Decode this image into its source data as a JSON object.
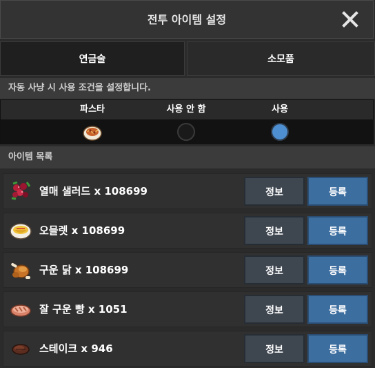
{
  "header": {
    "title": "전투 아이템 설정",
    "close_icon": "close-icon"
  },
  "tabs": [
    {
      "label": "연금술",
      "active": true
    },
    {
      "label": "소모품",
      "active": false
    }
  ],
  "auto_hunt": {
    "description": "자동 사냥 시 사용 조건을 설정합니다.",
    "columns": [
      "파스타",
      "사용 안 함",
      "사용"
    ],
    "item_icon": "pasta-icon",
    "selected": "사용"
  },
  "item_list": {
    "title": "아이템 목록",
    "info_label": "정보",
    "register_label": "등록",
    "items": [
      {
        "name": "열매 샐러드 x 108699",
        "icon": "berry-salad-icon"
      },
      {
        "name": "오믈렛 x 108699",
        "icon": "omelette-icon"
      },
      {
        "name": "구운 닭 x 108699",
        "icon": "roast-chicken-icon"
      },
      {
        "name": "잘 구운 빵 x 1051",
        "icon": "baked-bread-icon"
      },
      {
        "name": "스테이크 x 946",
        "icon": "steak-icon"
      }
    ]
  },
  "colors": {
    "accent_blue": "#3d6ea0",
    "radio_selected": "#4e8fd1"
  }
}
